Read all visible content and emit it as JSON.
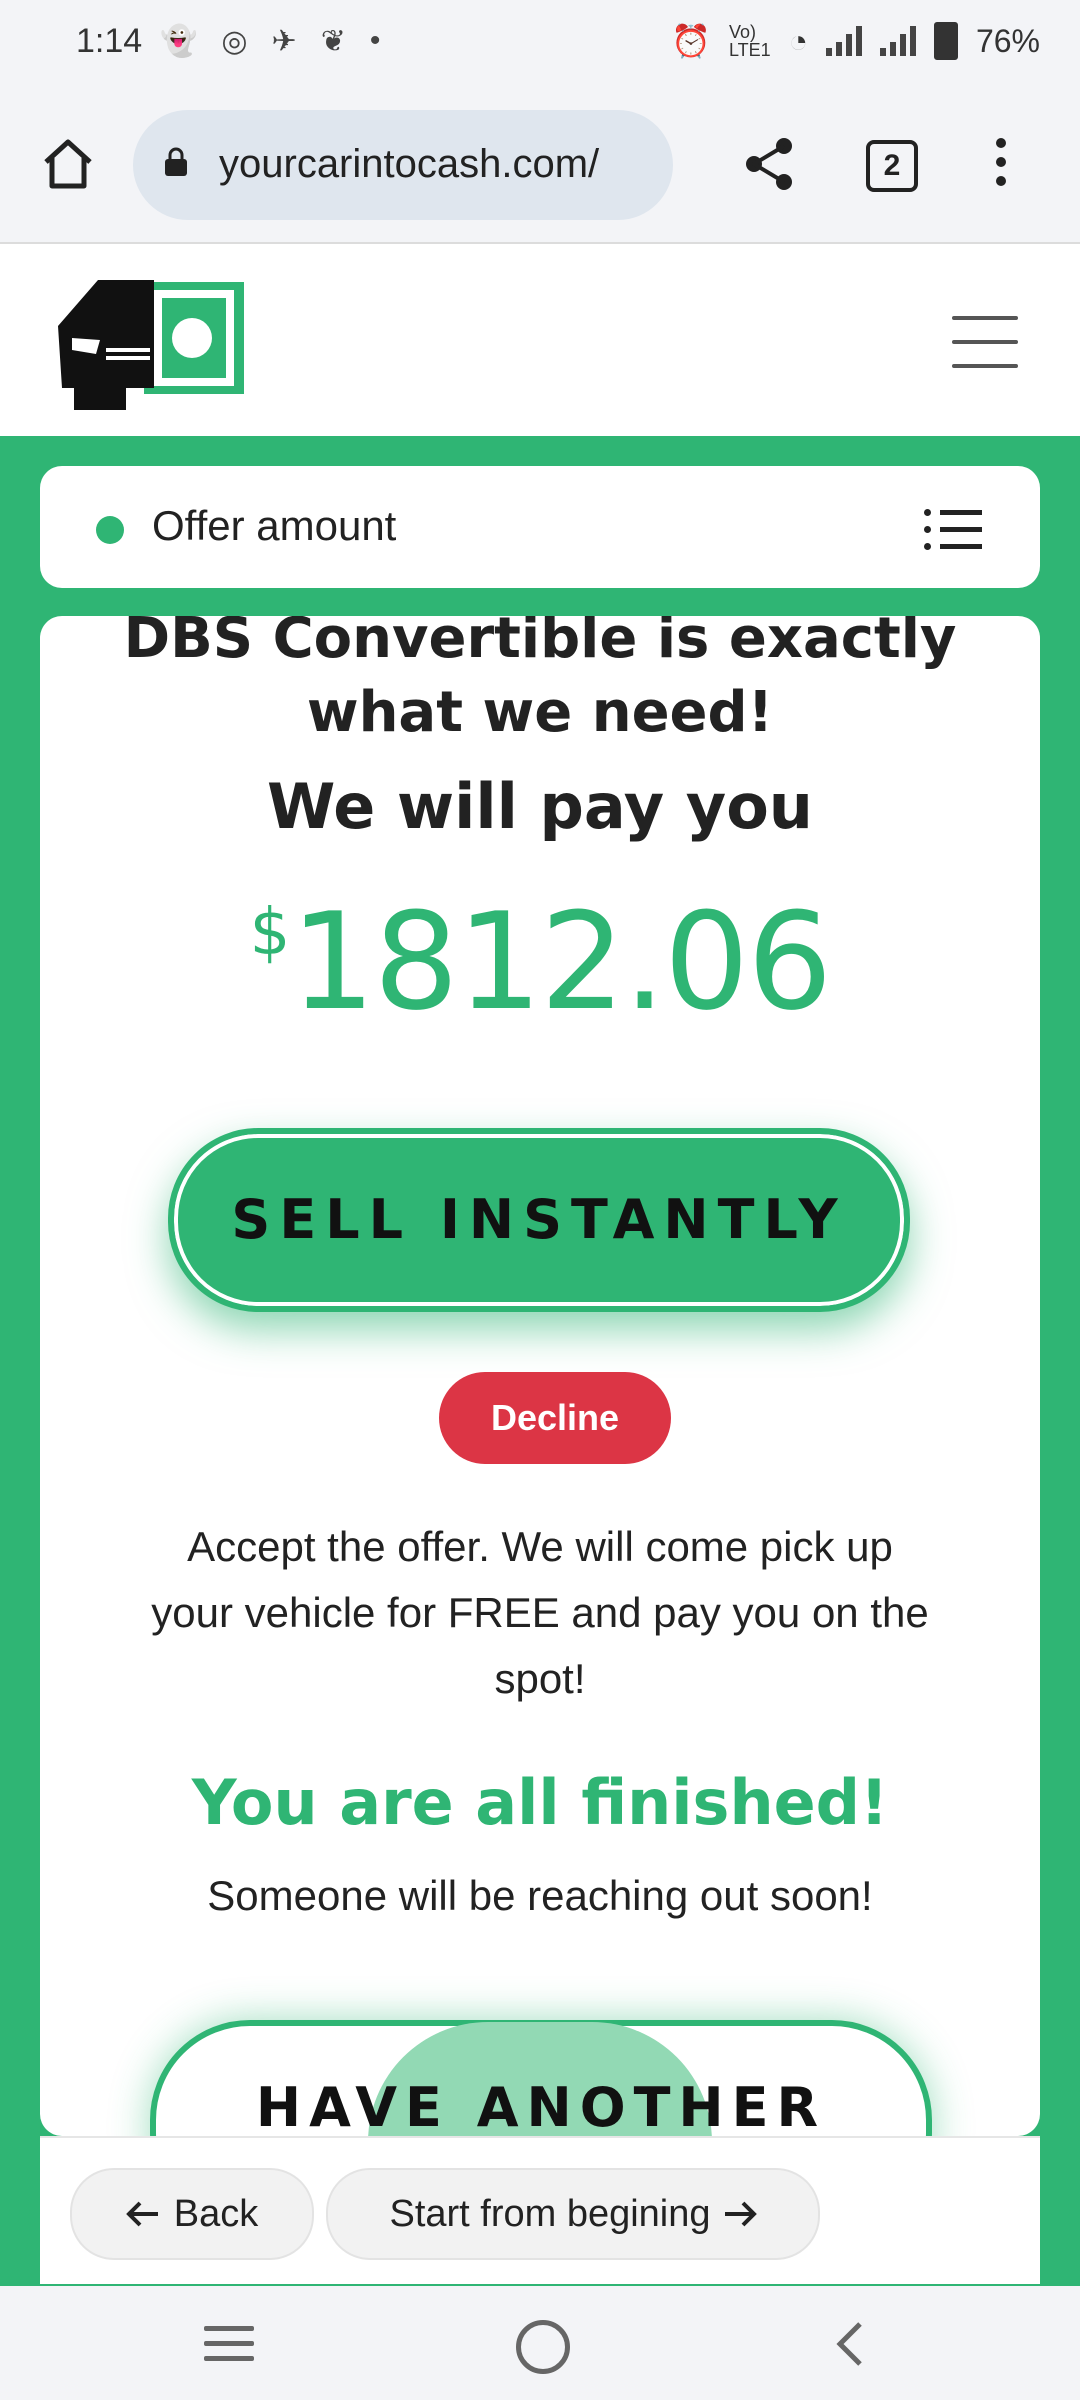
{
  "status_bar": {
    "time": "1:14",
    "left_icons": [
      "snapchat-icon",
      "instagram-icon",
      "messaging-icon",
      "leaf-icon",
      "dot-icon"
    ],
    "battery": "76%"
  },
  "browser": {
    "url": "yourcarintocash.com/",
    "tab_count": "2"
  },
  "offer_bar": {
    "label": "Offer amount"
  },
  "offer": {
    "headline": "DBS Convertible is exactly what we need!",
    "pay_line": "We will pay you",
    "currency": "$",
    "amount": "1812.06",
    "sell_label": "SELL INSTANTLY",
    "decline_label": "Decline",
    "accept_text": "Accept the offer. We will come pick up your vehicle for FREE and pay you on the spot!",
    "finished": "You are all finished!",
    "reaching": "Someone will be reaching out soon!",
    "another_label": "HAVE ANOTHER"
  },
  "bottom_nav": {
    "back_label": "Back",
    "start_label": "Start from begining"
  },
  "colors": {
    "brand_green": "#2fb574",
    "decline_red": "#dc3545"
  }
}
